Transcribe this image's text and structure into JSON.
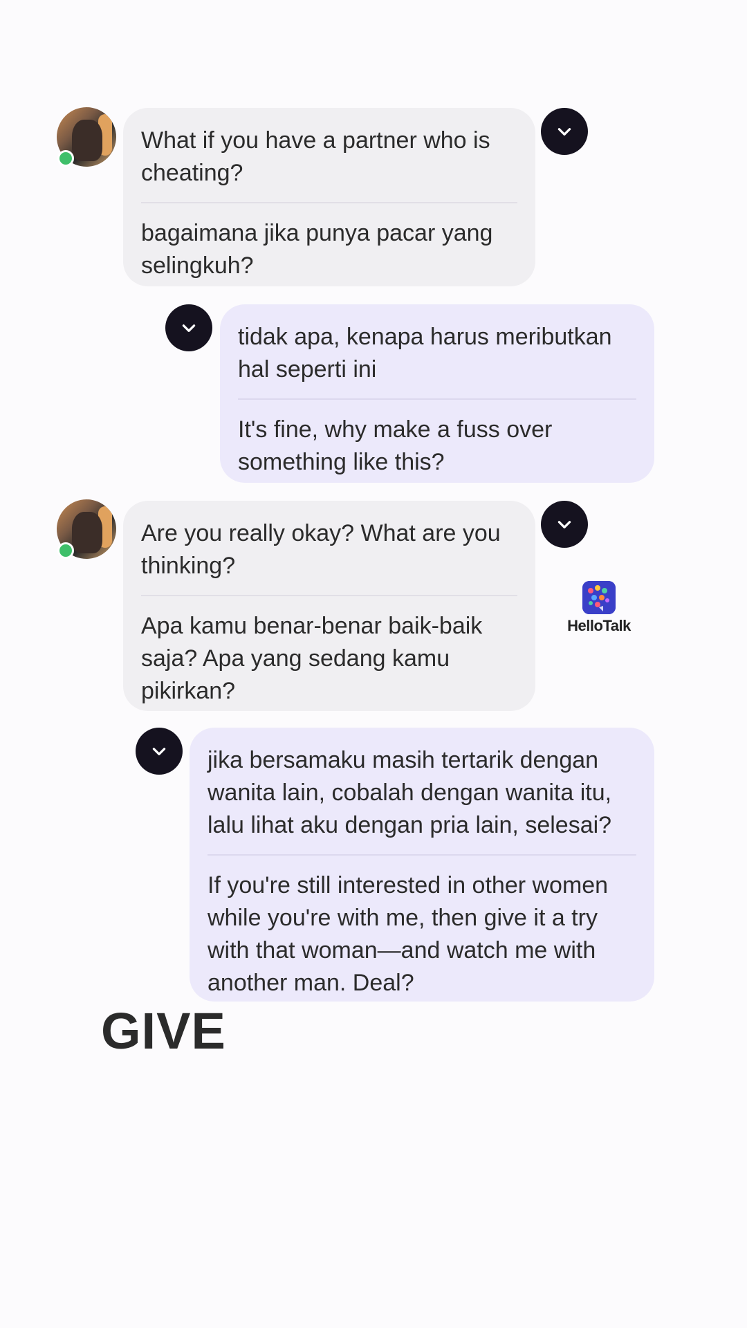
{
  "messages": [
    {
      "side": "incoming",
      "original_lines": [
        "What if you have a partner who is",
        "cheating?"
      ],
      "translation_lines": [
        "bagaimana jika punya pacar yang",
        "selingkuh?"
      ]
    },
    {
      "side": "outgoing",
      "original_lines": [
        "tidak apa, kenapa harus meributkan",
        "hal seperti ini"
      ],
      "translation_lines": [
        "It's fine, why make a fuss over",
        "something like this?"
      ]
    },
    {
      "side": "incoming",
      "original_lines": [
        "Are you really okay? What are you",
        "thinking?"
      ],
      "translation_lines": [
        "Apa kamu benar-benar baik-baik",
        "saja? Apa yang sedang kamu",
        "pikirkan?"
      ]
    },
    {
      "side": "outgoing",
      "original_lines": [
        "jika bersamaku masih tertarik dengan",
        "wanita lain, cobalah dengan wanita itu,",
        "lalu lihat aku dengan pria lain, selesai?"
      ],
      "translation_lines": [
        "If you're still interested in other women",
        "while you're with me, then give it a try",
        "with that woman—and watch me with",
        "another man. Deal?"
      ]
    }
  ],
  "watermark": {
    "label": "HelloTalk",
    "icon": "hellotalk-logo-icon"
  },
  "caption": "GIVE",
  "icons": {
    "message_menu": "chevron-down-icon",
    "avatar": "user-avatar",
    "presence": "online-status-dot"
  },
  "colors": {
    "incoming_bubble": "#f0eff2",
    "outgoing_bubble": "#ece9fb",
    "menu_button": "#15121f",
    "online": "#3fbf6a"
  }
}
